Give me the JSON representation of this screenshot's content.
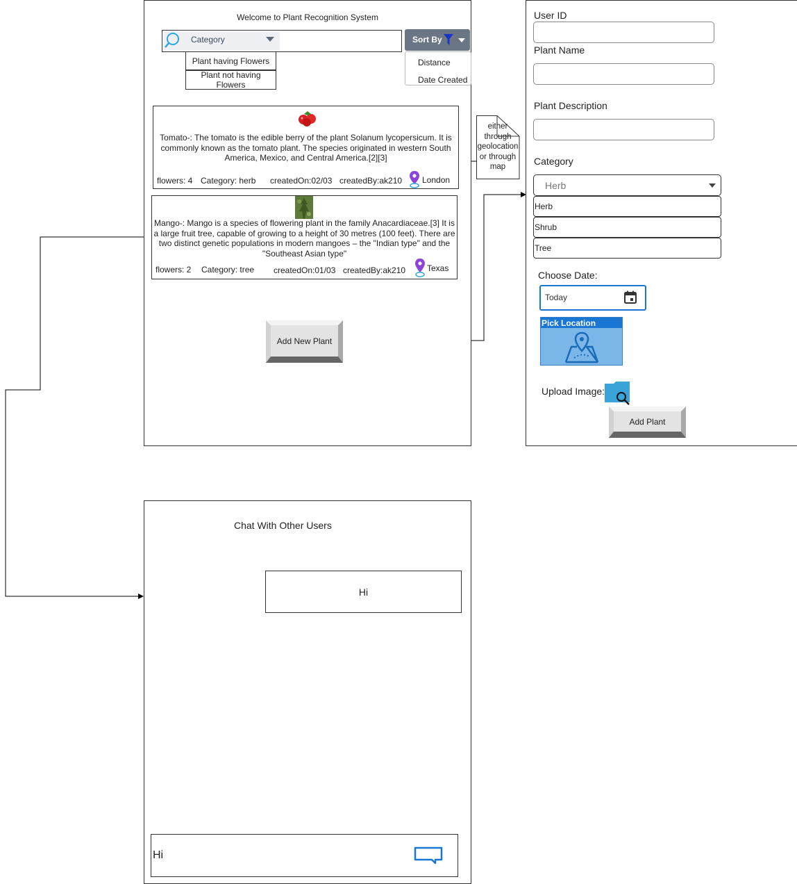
{
  "home": {
    "title": "Welcome to Plant Recognition System",
    "category_label": "Category",
    "category_options": [
      "Plant having Flowers",
      "Plant not having Flowers"
    ],
    "sort_label": "Sort By",
    "sort_options": [
      "Distance",
      "Date Created"
    ],
    "add_button": "Add New Plant"
  },
  "plants": [
    {
      "description": "Tomato-: The tomato  is the edible berry of the plant Solanum lycopersicum. It is commonly known as the tomato plant. The species originated in western South America, Mexico, and Central America.[2][3]",
      "flowers": "flowers: 4",
      "category": "Category: herb",
      "created_on": "createdOn:02/03",
      "created_by": "createdBy:ak210",
      "location": "London"
    },
    {
      "description": "Mango-: Mango is a species of flowering plant in the family Anacardiaceae.[3] It is a large fruit tree, capable of growing to a height of 30 metres (100 feet). There are two distinct genetic populations in modern mangoes – the \"Indian type\" and the \"Southeast Asian type\"",
      "flowers": "flowers: 2",
      "category": "Category: tree",
      "created_on": "createdOn:01/03",
      "created_by": "createdBy:ak210",
      "location": "Texas"
    }
  ],
  "note": "either through geolocation or through map",
  "form": {
    "user_id_label": "User ID",
    "plant_name_label": "Plant Name",
    "description_label": "Plant Description",
    "category_label": "Category",
    "category_selected": "Herb",
    "category_options": [
      "Herb",
      "Shrub",
      "Tree"
    ],
    "date_label": "Choose Date:",
    "date_value": "Today",
    "pick_location": "Pick Location",
    "upload_label": "Upload Image:",
    "submit": "Add Plant"
  },
  "chat": {
    "title": "Chat With Other Users",
    "message": "Hi",
    "input_value": "Hi"
  },
  "colors": {
    "sort_bg": "#6b7684",
    "funnel": "#1a33cc",
    "accent_blue": "#1976d2",
    "pin_purple": "#8e44d8",
    "folder_blue": "#3ba3d8"
  }
}
